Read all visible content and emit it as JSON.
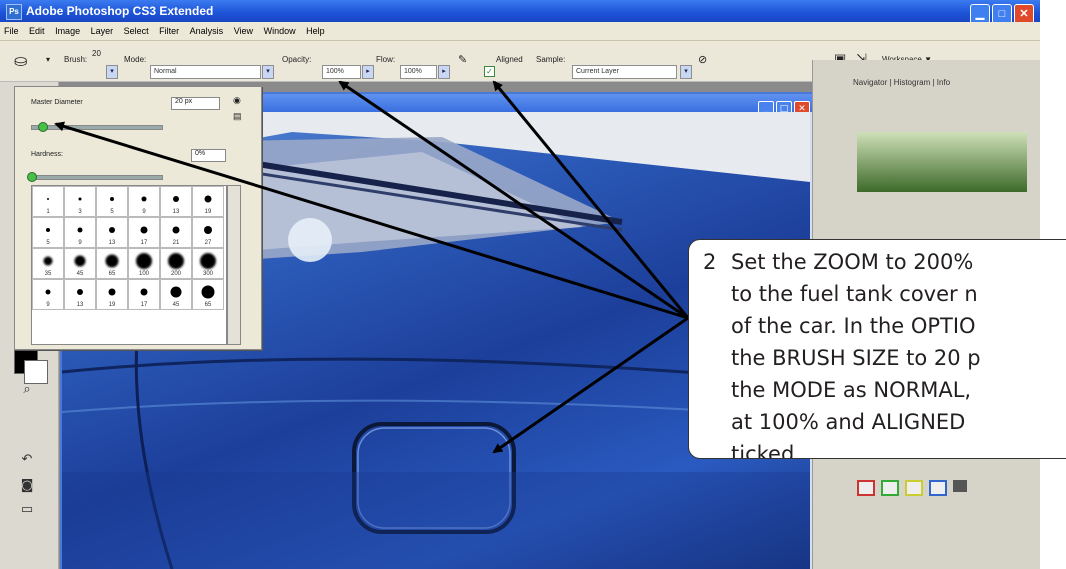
{
  "window": {
    "title": "Adobe Photoshop CS3 Extended",
    "app_badge": "Ps",
    "buttons": [
      "minimize",
      "maximize",
      "close"
    ]
  },
  "menu": [
    "File",
    "Edit",
    "Image",
    "Layer",
    "Select",
    "Filter",
    "Analysis",
    "View",
    "Window",
    "Help"
  ],
  "options_bar": {
    "brush_label": "Brush:",
    "brush_size": "20",
    "mode_label": "Mode:",
    "mode_value": "Normal",
    "opacity_label": "Opacity:",
    "opacity_value": "100%",
    "flow_label": "Flow:",
    "flow_value": "100%",
    "aligned_label": "Aligned",
    "aligned_checked": true,
    "sample_label": "Sample:",
    "sample_value": "Current Layer",
    "workspace_label": "Workspace ▼"
  },
  "brush_panel": {
    "master_diameter_label": "Master Diameter",
    "master_diameter_value": "20 px",
    "hardness_label": "Hardness:",
    "hardness_value": "0%",
    "master_diameter_level": 0.08,
    "hardness_level": 0.0,
    "presets": [
      {
        "size": 1,
        "label": "1"
      },
      {
        "size": 3,
        "label": "3"
      },
      {
        "size": 5,
        "label": "5"
      },
      {
        "size": 9,
        "label": "9"
      },
      {
        "size": 13,
        "label": "13"
      },
      {
        "size": 19,
        "label": "19"
      },
      {
        "size": 5,
        "label": "5"
      },
      {
        "size": 9,
        "label": "9"
      },
      {
        "size": 13,
        "label": "13"
      },
      {
        "size": 17,
        "label": "17"
      },
      {
        "size": 21,
        "label": "21"
      },
      {
        "size": 27,
        "label": "27"
      },
      {
        "size": 35,
        "label": "35"
      },
      {
        "size": 45,
        "label": "45"
      },
      {
        "size": 65,
        "label": "65"
      },
      {
        "size": 100,
        "label": "100"
      },
      {
        "size": 200,
        "label": "200"
      },
      {
        "size": 300,
        "label": "300"
      },
      {
        "size": 9,
        "label": "9"
      },
      {
        "size": 13,
        "label": "13"
      },
      {
        "size": 19,
        "label": "19"
      },
      {
        "size": 17,
        "label": "17"
      },
      {
        "size": 45,
        "label": "45"
      },
      {
        "size": 65,
        "label": "65"
      }
    ]
  },
  "panels": {
    "tabs": [
      "Navigator",
      "Histogram",
      "Info"
    ]
  },
  "callout": {
    "step": "2",
    "text": "Set the ZOOM to 200%\nto the fuel tank cover n\nof the car.  In the OPTIO\nthe BRUSH SIZE to 20 p\nthe MODE as NORMAL,\nat 100% and ALIGNED \nticked."
  },
  "colors": {
    "title_bar": "#1c52d6",
    "car_blue": "#2d5cba",
    "arrow": "#000000"
  }
}
